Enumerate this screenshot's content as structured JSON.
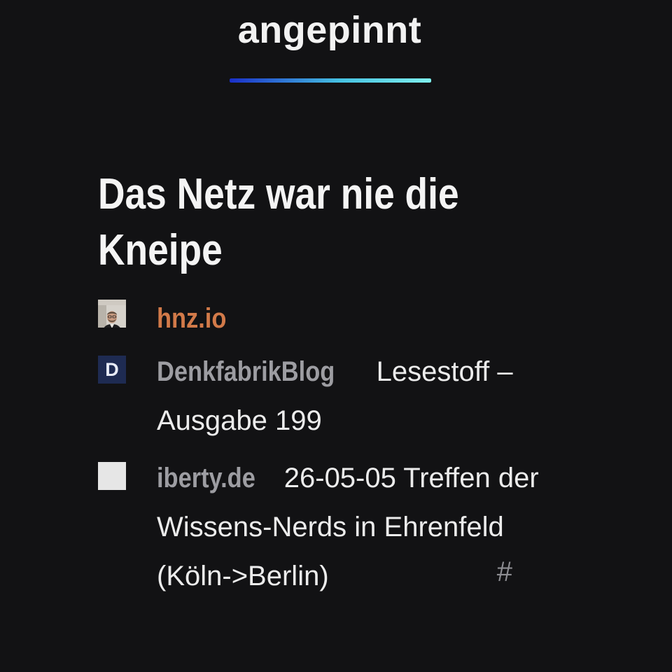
{
  "header": {
    "title": "angepinnt",
    "underline_gradient": [
      "#1a2fc9",
      "#46c2e2",
      "#7ff0ee"
    ]
  },
  "article": {
    "headline": "Das Netz war nie die Kneipe"
  },
  "entries": [
    {
      "icon": "avatar-photo-icon",
      "source": "hnz.io",
      "source_color": "#d27a49",
      "title": ""
    },
    {
      "icon": "denkfabrik-d-icon",
      "icon_letter": "D",
      "source": "DenkfabrikBlog",
      "title": "Lesestoff – Ausgabe 199"
    },
    {
      "icon": "color-wheel-icon",
      "source": "iberty.de",
      "title": "26-05-05 Treffen der Wissens-Nerds in Ehrenfeld (Köln->Berlin)",
      "permalink": "#"
    }
  ],
  "colors": {
    "background": "#121214",
    "text": "#ececec",
    "muted": "#9d9da2",
    "accent": "#d27a49"
  }
}
